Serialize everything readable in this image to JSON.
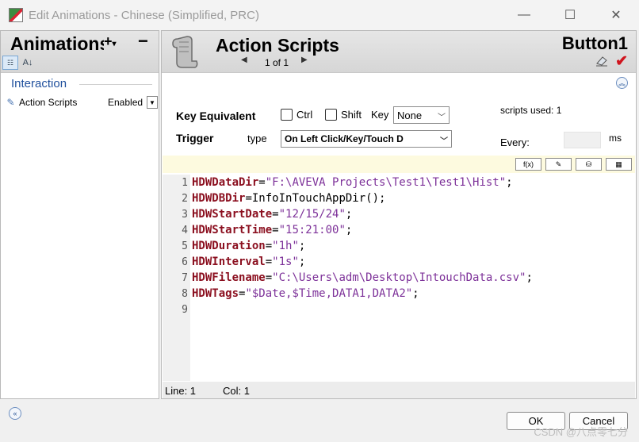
{
  "window": {
    "title": "Edit Animations - Chinese (Simplified, PRC)",
    "minimize": "—",
    "maximize": "☐",
    "close": "✕"
  },
  "left": {
    "title": "Animations",
    "add": "+",
    "add_caret": "▾",
    "collapse": "−",
    "section": "Interaction",
    "items": [
      {
        "name": "Action Scripts",
        "status": "Enabled"
      }
    ],
    "expand_icon": "«"
  },
  "right": {
    "title": "Action Scripts",
    "pager": "1 of 1",
    "pager_prev": "◀",
    "pager_next": "▶",
    "object": "Button1",
    "check": "✔",
    "collapse_icon": "«",
    "key_equivalent_label": "Key Equivalent",
    "ctrl_label": "Ctrl",
    "shift_label": "Shift",
    "key_label": "Key",
    "key_value": "None",
    "trigger_label": "Trigger",
    "type_label": "type",
    "trigger_value": "On Left Click/Key/Touch D",
    "scripts_used_label": "scripts used:",
    "scripts_used_value": "1",
    "every_label": "Every:",
    "ms_label": "ms",
    "toolbar": [
      "f(x)",
      "✎",
      "⛁",
      "▦"
    ],
    "code_lines": [
      {
        "n": "1",
        "var": "HDWDataDir",
        "op": "=",
        "str": "\"F:\\AVEVA Projects\\Test1\\Test1\\Hist\"",
        "tail": ";"
      },
      {
        "n": "2",
        "var": "HDWDBDir",
        "op": "=InfoInTouchAppDir();",
        "str": "",
        "tail": ""
      },
      {
        "n": "3",
        "var": "HDWStartDate",
        "op": "=",
        "str": "\"12/15/24\"",
        "tail": ";"
      },
      {
        "n": "4",
        "var": "HDWStartTime",
        "op": "=",
        "str": "\"15:21:00\"",
        "tail": ";"
      },
      {
        "n": "5",
        "var": "HDWDuration",
        "op": "=",
        "str": "\"1h\"",
        "tail": ";"
      },
      {
        "n": "6",
        "var": "HDWInterval",
        "op": "=",
        "str": "\"1s\"",
        "tail": ";"
      },
      {
        "n": "7",
        "var": "HDWFilename",
        "op": "=",
        "str": "\"C:\\Users\\adm\\Desktop\\IntouchData.csv\"",
        "tail": ";"
      },
      {
        "n": "8",
        "var": "HDWTags",
        "op": "=",
        "str": "\"$Date,$Time,DATA1,DATA2\"",
        "tail": ";"
      },
      {
        "n": "9",
        "var": "",
        "op": "",
        "str": "",
        "tail": ""
      }
    ],
    "status_line": "Line:  1",
    "status_col": "Col:  1"
  },
  "buttons": {
    "ok": "OK",
    "cancel": "Cancel"
  },
  "watermark": "CSDN @八点零七分"
}
